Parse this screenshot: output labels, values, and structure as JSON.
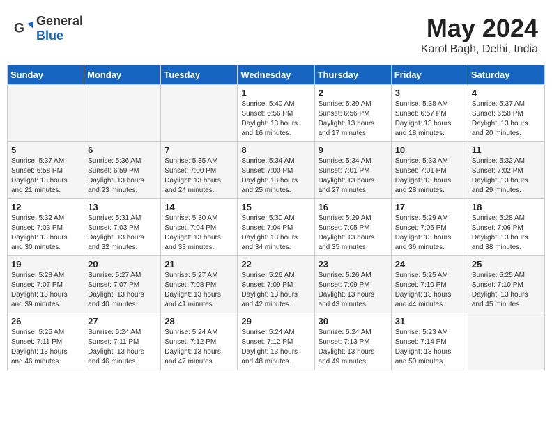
{
  "header": {
    "logo_general": "General",
    "logo_blue": "Blue",
    "month_year": "May 2024",
    "location": "Karol Bagh, Delhi, India"
  },
  "weekdays": [
    "Sunday",
    "Monday",
    "Tuesday",
    "Wednesday",
    "Thursday",
    "Friday",
    "Saturday"
  ],
  "weeks": [
    {
      "shade": false,
      "days": [
        {
          "num": "",
          "empty": true,
          "info": ""
        },
        {
          "num": "",
          "empty": true,
          "info": ""
        },
        {
          "num": "",
          "empty": true,
          "info": ""
        },
        {
          "num": "1",
          "empty": false,
          "info": "Sunrise: 5:40 AM\nSunset: 6:56 PM\nDaylight: 13 hours\nand 16 minutes."
        },
        {
          "num": "2",
          "empty": false,
          "info": "Sunrise: 5:39 AM\nSunset: 6:56 PM\nDaylight: 13 hours\nand 17 minutes."
        },
        {
          "num": "3",
          "empty": false,
          "info": "Sunrise: 5:38 AM\nSunset: 6:57 PM\nDaylight: 13 hours\nand 18 minutes."
        },
        {
          "num": "4",
          "empty": false,
          "info": "Sunrise: 5:37 AM\nSunset: 6:58 PM\nDaylight: 13 hours\nand 20 minutes."
        }
      ]
    },
    {
      "shade": true,
      "days": [
        {
          "num": "5",
          "empty": false,
          "info": "Sunrise: 5:37 AM\nSunset: 6:58 PM\nDaylight: 13 hours\nand 21 minutes."
        },
        {
          "num": "6",
          "empty": false,
          "info": "Sunrise: 5:36 AM\nSunset: 6:59 PM\nDaylight: 13 hours\nand 23 minutes."
        },
        {
          "num": "7",
          "empty": false,
          "info": "Sunrise: 5:35 AM\nSunset: 7:00 PM\nDaylight: 13 hours\nand 24 minutes."
        },
        {
          "num": "8",
          "empty": false,
          "info": "Sunrise: 5:34 AM\nSunset: 7:00 PM\nDaylight: 13 hours\nand 25 minutes."
        },
        {
          "num": "9",
          "empty": false,
          "info": "Sunrise: 5:34 AM\nSunset: 7:01 PM\nDaylight: 13 hours\nand 27 minutes."
        },
        {
          "num": "10",
          "empty": false,
          "info": "Sunrise: 5:33 AM\nSunset: 7:01 PM\nDaylight: 13 hours\nand 28 minutes."
        },
        {
          "num": "11",
          "empty": false,
          "info": "Sunrise: 5:32 AM\nSunset: 7:02 PM\nDaylight: 13 hours\nand 29 minutes."
        }
      ]
    },
    {
      "shade": false,
      "days": [
        {
          "num": "12",
          "empty": false,
          "info": "Sunrise: 5:32 AM\nSunset: 7:03 PM\nDaylight: 13 hours\nand 30 minutes."
        },
        {
          "num": "13",
          "empty": false,
          "info": "Sunrise: 5:31 AM\nSunset: 7:03 PM\nDaylight: 13 hours\nand 32 minutes."
        },
        {
          "num": "14",
          "empty": false,
          "info": "Sunrise: 5:30 AM\nSunset: 7:04 PM\nDaylight: 13 hours\nand 33 minutes."
        },
        {
          "num": "15",
          "empty": false,
          "info": "Sunrise: 5:30 AM\nSunset: 7:04 PM\nDaylight: 13 hours\nand 34 minutes."
        },
        {
          "num": "16",
          "empty": false,
          "info": "Sunrise: 5:29 AM\nSunset: 7:05 PM\nDaylight: 13 hours\nand 35 minutes."
        },
        {
          "num": "17",
          "empty": false,
          "info": "Sunrise: 5:29 AM\nSunset: 7:06 PM\nDaylight: 13 hours\nand 36 minutes."
        },
        {
          "num": "18",
          "empty": false,
          "info": "Sunrise: 5:28 AM\nSunset: 7:06 PM\nDaylight: 13 hours\nand 38 minutes."
        }
      ]
    },
    {
      "shade": true,
      "days": [
        {
          "num": "19",
          "empty": false,
          "info": "Sunrise: 5:28 AM\nSunset: 7:07 PM\nDaylight: 13 hours\nand 39 minutes."
        },
        {
          "num": "20",
          "empty": false,
          "info": "Sunrise: 5:27 AM\nSunset: 7:07 PM\nDaylight: 13 hours\nand 40 minutes."
        },
        {
          "num": "21",
          "empty": false,
          "info": "Sunrise: 5:27 AM\nSunset: 7:08 PM\nDaylight: 13 hours\nand 41 minutes."
        },
        {
          "num": "22",
          "empty": false,
          "info": "Sunrise: 5:26 AM\nSunset: 7:09 PM\nDaylight: 13 hours\nand 42 minutes."
        },
        {
          "num": "23",
          "empty": false,
          "info": "Sunrise: 5:26 AM\nSunset: 7:09 PM\nDaylight: 13 hours\nand 43 minutes."
        },
        {
          "num": "24",
          "empty": false,
          "info": "Sunrise: 5:25 AM\nSunset: 7:10 PM\nDaylight: 13 hours\nand 44 minutes."
        },
        {
          "num": "25",
          "empty": false,
          "info": "Sunrise: 5:25 AM\nSunset: 7:10 PM\nDaylight: 13 hours\nand 45 minutes."
        }
      ]
    },
    {
      "shade": false,
      "days": [
        {
          "num": "26",
          "empty": false,
          "info": "Sunrise: 5:25 AM\nSunset: 7:11 PM\nDaylight: 13 hours\nand 46 minutes."
        },
        {
          "num": "27",
          "empty": false,
          "info": "Sunrise: 5:24 AM\nSunset: 7:11 PM\nDaylight: 13 hours\nand 46 minutes."
        },
        {
          "num": "28",
          "empty": false,
          "info": "Sunrise: 5:24 AM\nSunset: 7:12 PM\nDaylight: 13 hours\nand 47 minutes."
        },
        {
          "num": "29",
          "empty": false,
          "info": "Sunrise: 5:24 AM\nSunset: 7:12 PM\nDaylight: 13 hours\nand 48 minutes."
        },
        {
          "num": "30",
          "empty": false,
          "info": "Sunrise: 5:24 AM\nSunset: 7:13 PM\nDaylight: 13 hours\nand 49 minutes."
        },
        {
          "num": "31",
          "empty": false,
          "info": "Sunrise: 5:23 AM\nSunset: 7:14 PM\nDaylight: 13 hours\nand 50 minutes."
        },
        {
          "num": "",
          "empty": true,
          "info": ""
        }
      ]
    }
  ]
}
